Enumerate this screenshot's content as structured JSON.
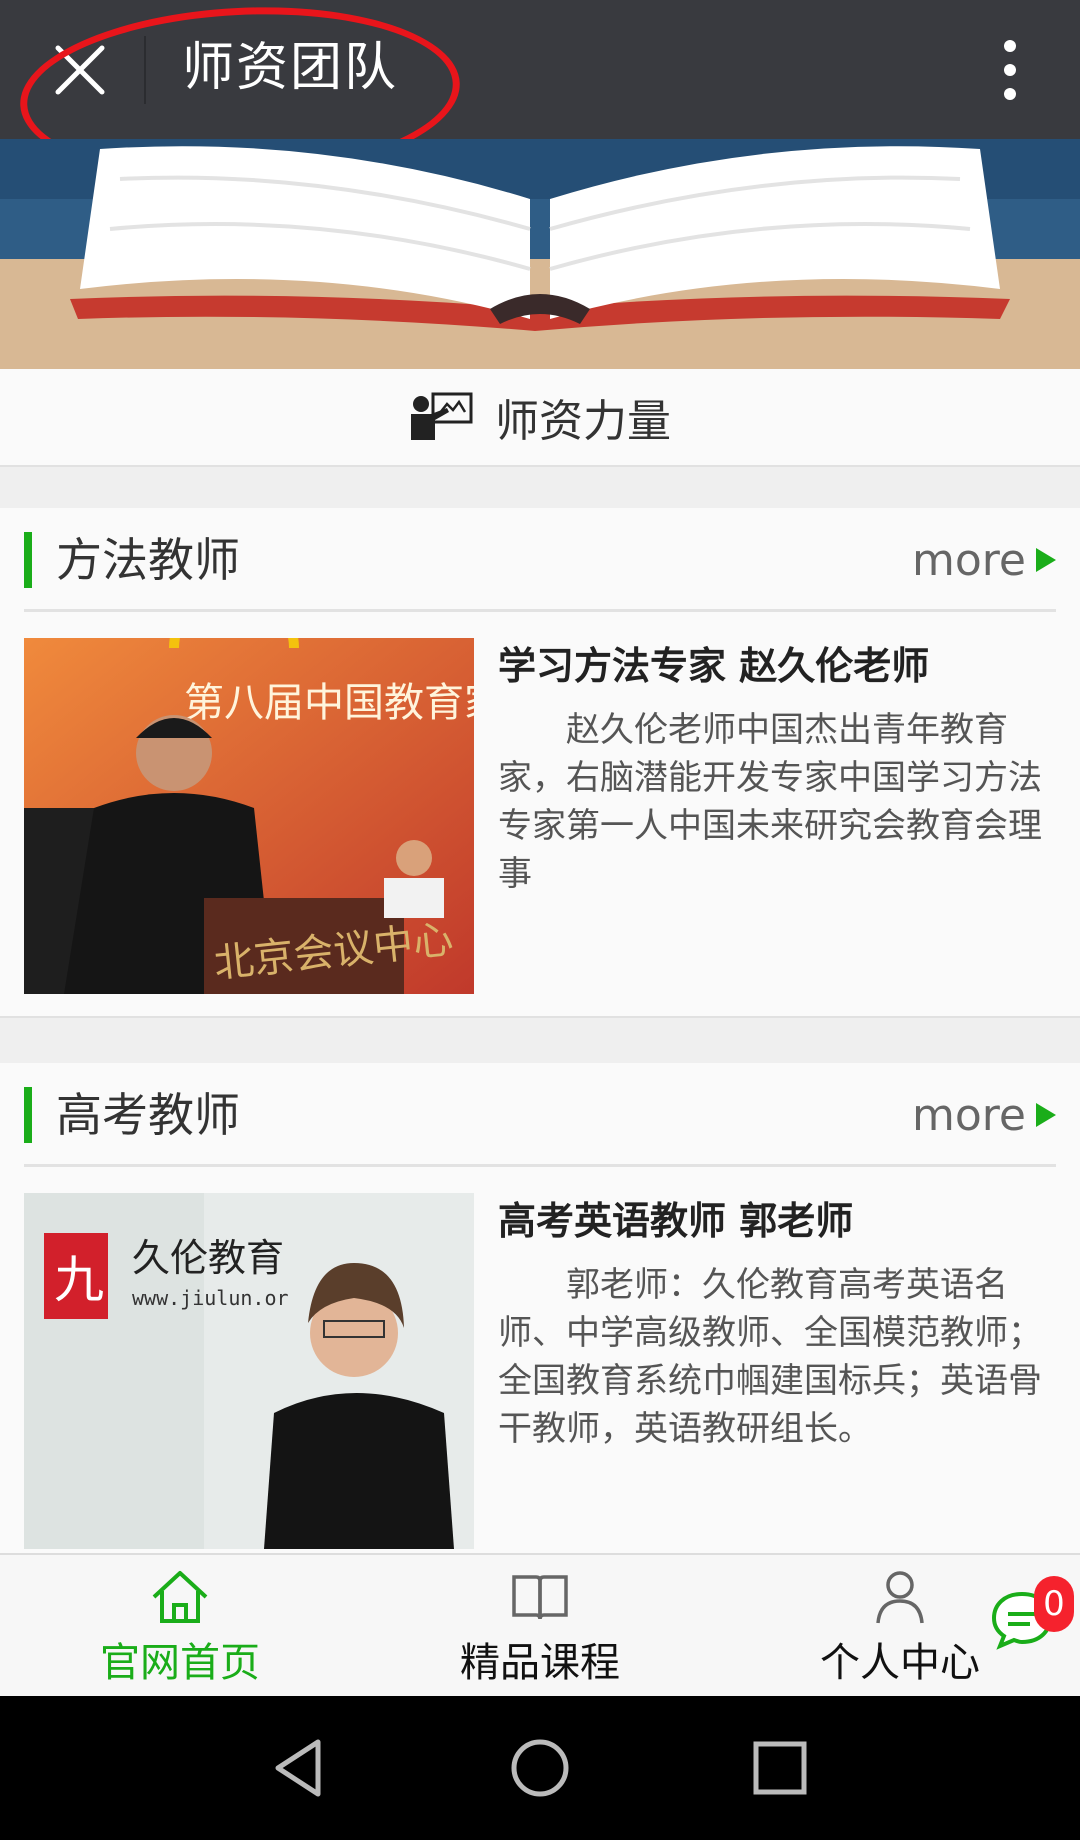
{
  "header": {
    "title": "师资团队",
    "close_icon": "close-icon",
    "menu_icon": "more-vertical-icon",
    "background": "#393a3f"
  },
  "section": {
    "icon": "teacher-presentation-icon",
    "label": "师资力量"
  },
  "categories": [
    {
      "title": "方法教师",
      "more": "more",
      "teacher": {
        "name": "学习方法专家 赵久伦老师",
        "description": "赵久伦老师中国杰出青年教育家，右脑潜能开发专家中国学习方法专家第一人中国未来研究会教育会理事",
        "photo_banner_text": "第八届中国教育家大会",
        "photo_podium_text": "北京会议中心"
      }
    },
    {
      "title": "高考教师",
      "more": "more",
      "teacher": {
        "name": "高考英语教师 郭老师",
        "description": "郭老师：久伦教育高考英语名师、中学高级教师、全国模范教师；全国教育系统巾帼建国标兵；英语骨干教师，英语教研组长。",
        "photo_logo_text": "久伦教育",
        "photo_logo_url": "www.jiulun.or"
      }
    }
  ],
  "bottom_nav": {
    "items": [
      {
        "label": "官网首页",
        "icon": "home-icon",
        "active": true
      },
      {
        "label": "精品课程",
        "icon": "book-icon",
        "active": false
      },
      {
        "label": "个人中心",
        "icon": "user-icon",
        "active": false
      }
    ],
    "chat_badge": "0",
    "accent": "#1aad19"
  },
  "system_nav": {
    "back_icon": "back-triangle-icon",
    "home_icon": "home-circle-icon",
    "recents_icon": "recents-square-icon"
  }
}
